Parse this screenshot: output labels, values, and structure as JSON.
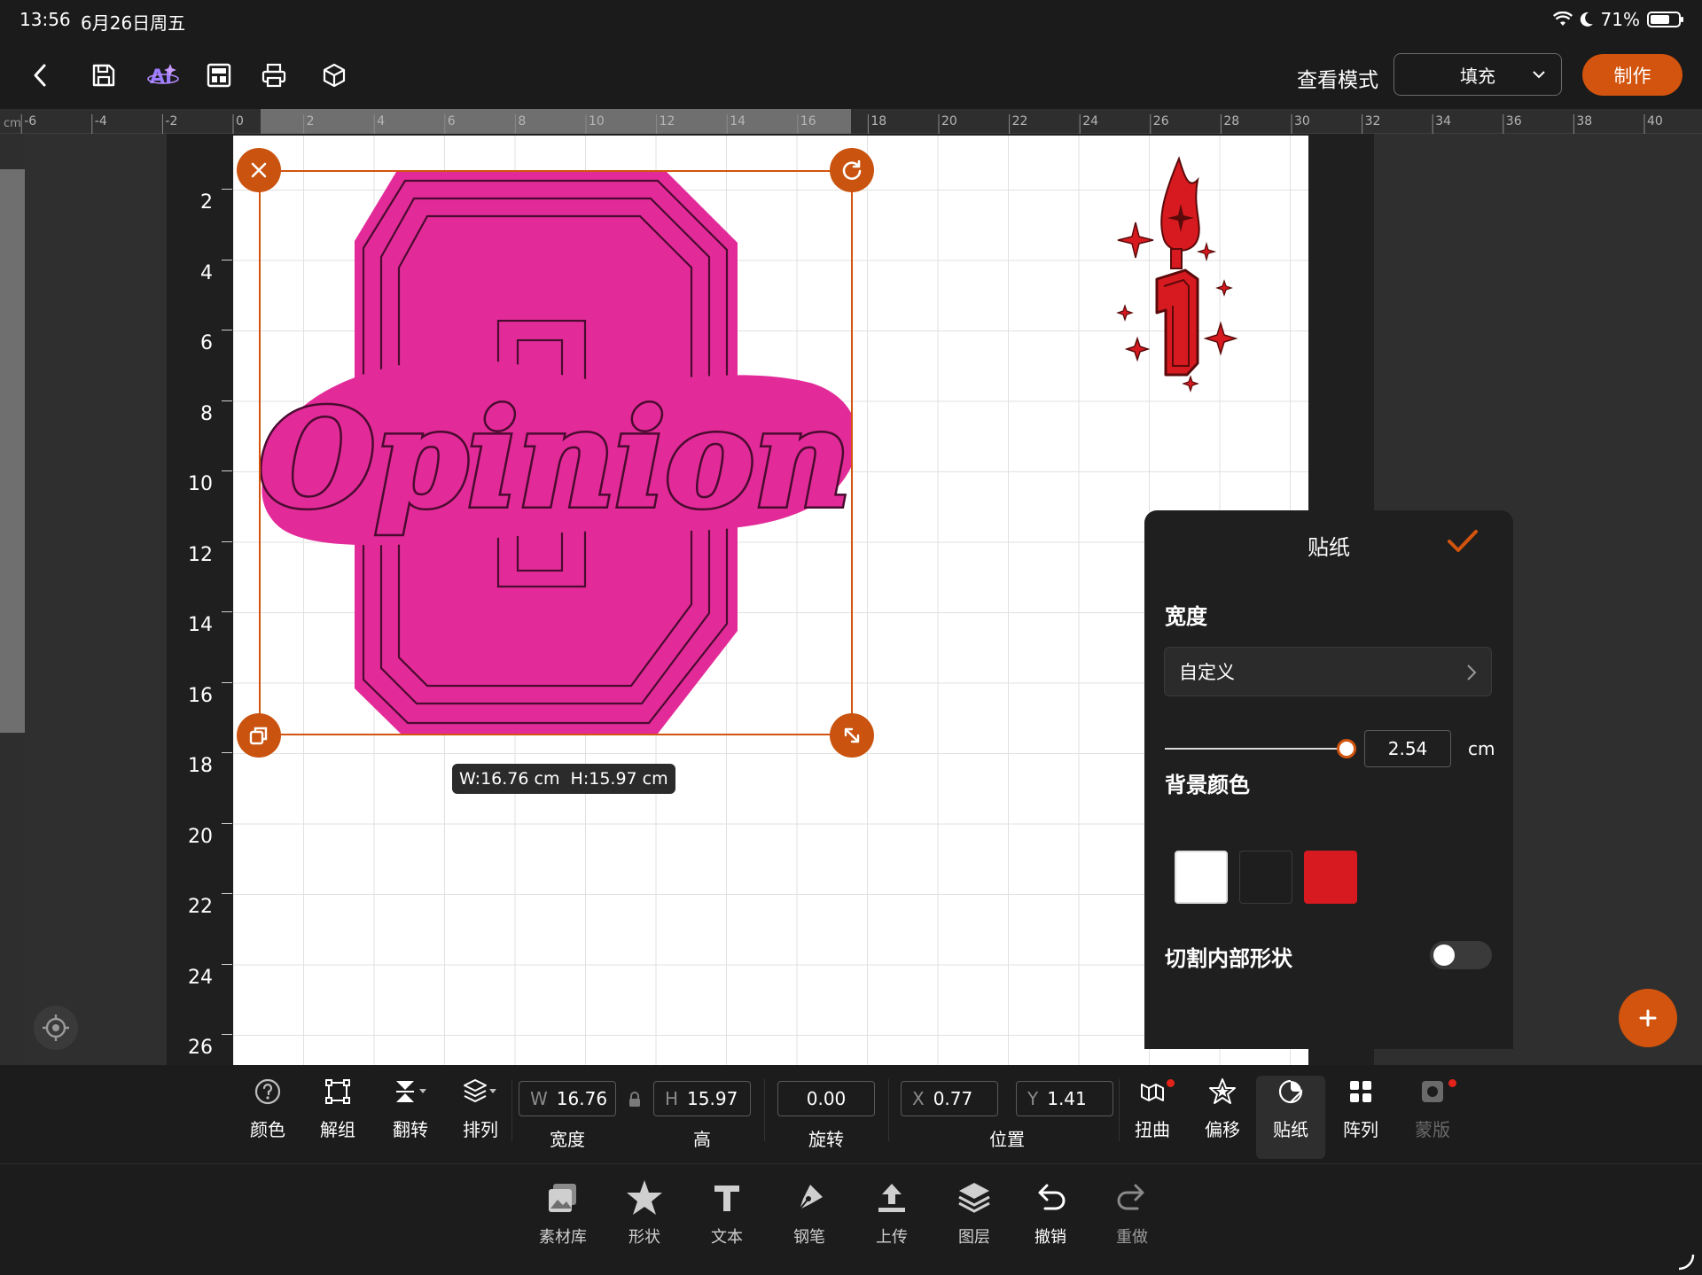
{
  "status_bar": {
    "time": "13:56",
    "date": "6月26日周五",
    "battery": "71%",
    "battery_level": 0.71
  },
  "toolbar": {
    "view_mode_label": "查看模式",
    "view_mode_value": "填充",
    "make_label": "制作",
    "icons": [
      "back-icon",
      "save-icon",
      "ai-icon",
      "template-icon",
      "print-icon",
      "3d-box-icon"
    ]
  },
  "ruler": {
    "unit": "cm",
    "x_ticks": [
      "-6",
      "-4",
      "-2",
      "0",
      "2",
      "4",
      "6",
      "8",
      "10",
      "12",
      "14",
      "16",
      "18",
      "20",
      "22",
      "24",
      "26",
      "28",
      "30",
      "32",
      "34",
      "36",
      "38",
      "40"
    ],
    "y_ticks": [
      "2",
      "4",
      "6",
      "8",
      "10",
      "12",
      "14",
      "16",
      "18",
      "20",
      "22",
      "24",
      "26"
    ]
  },
  "canvas": {
    "selection_size_label": "W:16.76 cm  H:15.97 cm",
    "design_text": "Opinion",
    "design_colors": {
      "sticker": "#e22b98",
      "candle": "#d71920"
    }
  },
  "sticker_panel": {
    "title": "贴纸",
    "width_label": "宽度",
    "width_mode": "自定义",
    "width_value": "2.54",
    "width_unit": "cm",
    "bg_color_label": "背景颜色",
    "bg_colors": [
      "#ffffff",
      "#1e1e1e",
      "#d71920"
    ],
    "bg_selected": "#ffffff",
    "cut_inner_label": "切割内部形状",
    "cut_inner_on": false
  },
  "property_bar": {
    "color": "颜色",
    "ungroup": "解组",
    "flip": "翻转",
    "arrange": "排列",
    "width_prefix": "W",
    "width_value": "16.76",
    "width_caption": "宽度",
    "height_prefix": "H",
    "height_value": "15.97",
    "height_caption": "高",
    "rotation_value": "0.00",
    "rotation_caption": "旋转",
    "x_prefix": "X",
    "x_value": "0.77",
    "y_prefix": "Y",
    "y_value": "1.41",
    "position_caption": "位置",
    "distort": "扭曲",
    "offset": "偏移",
    "sticker": "贴纸",
    "array": "阵列",
    "mask": "蒙版"
  },
  "bottom_tabs": [
    "素材库",
    "形状",
    "文本",
    "钢笔",
    "上传",
    "图层",
    "撤销",
    "重做"
  ]
}
